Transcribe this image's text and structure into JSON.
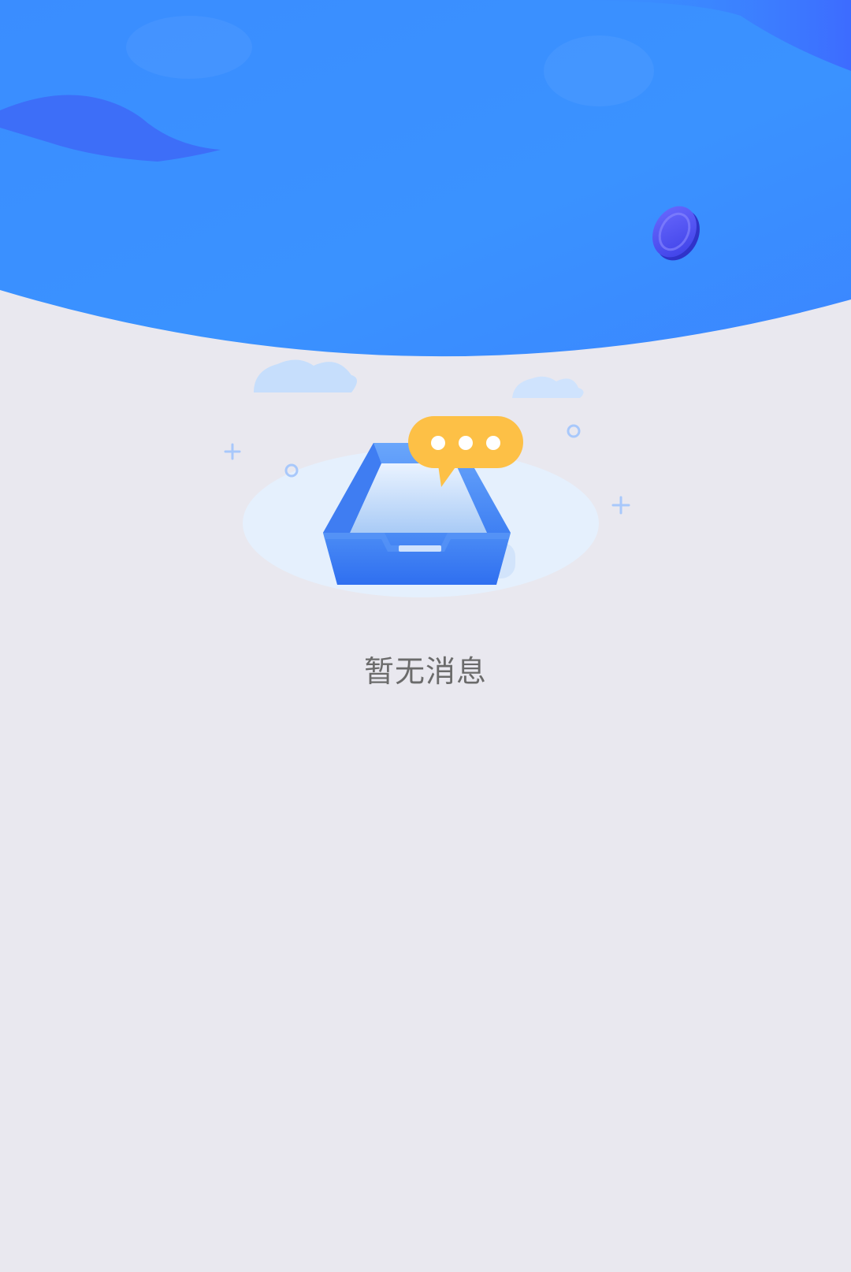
{
  "colors": {
    "page_background": "#e9e8ef",
    "banner_primary": "#3a91ff",
    "banner_accent": "#3f55ff",
    "inbox_blue": "#3d7cf2",
    "bubble_yellow": "#fdc046",
    "empty_text": "#6b6b6b"
  },
  "icons": {
    "banner": "wave-banner-icon",
    "coin": "coin-icon",
    "inbox": "inbox-tray-icon",
    "bubble": "chat-bubble-icon",
    "cloud": "cloud-icon",
    "sparkle": "plus-sparkle-icon"
  },
  "empty_state": {
    "message": "暂无消息"
  }
}
